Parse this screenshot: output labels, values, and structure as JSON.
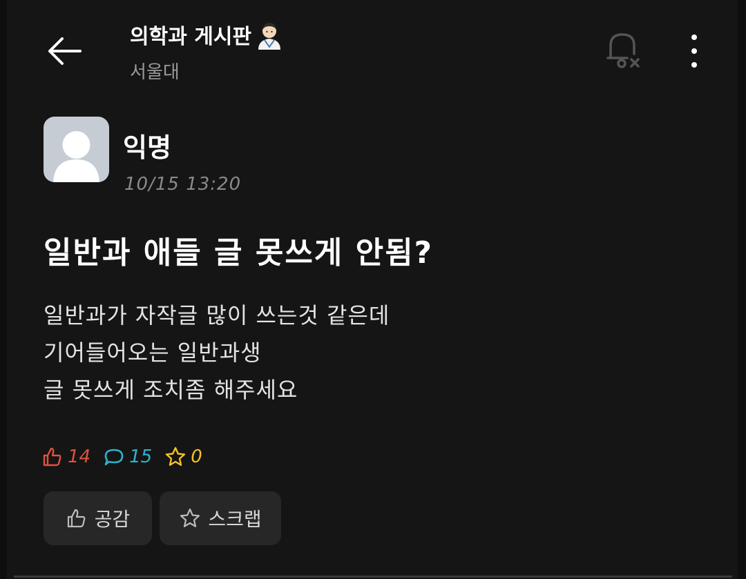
{
  "header": {
    "board_title": "의학과 게시판",
    "board_emoji": "doctor-emoji",
    "school": "서울대",
    "icons": {
      "back": "arrow-left-icon",
      "bell": "bell-off-icon",
      "more": "more-vertical-icon"
    }
  },
  "post": {
    "author": "익명",
    "time": "10/15 13:20",
    "title": "일반과 애들 글 못쓰게 안됨?",
    "body_lines": [
      "일반과가 자작글 많이 쓰는것 같은데",
      "기어들어오는 일반과생",
      "글 못쓰게 조치좀 해주세요"
    ]
  },
  "stats": {
    "likes": "14",
    "comments": "15",
    "scraps": "0",
    "colors": {
      "like": "#e0523f",
      "comment": "#2fb3cc",
      "scrap": "#f5c225"
    }
  },
  "actions": {
    "like_label": "공감",
    "scrap_label": "스크랩"
  }
}
